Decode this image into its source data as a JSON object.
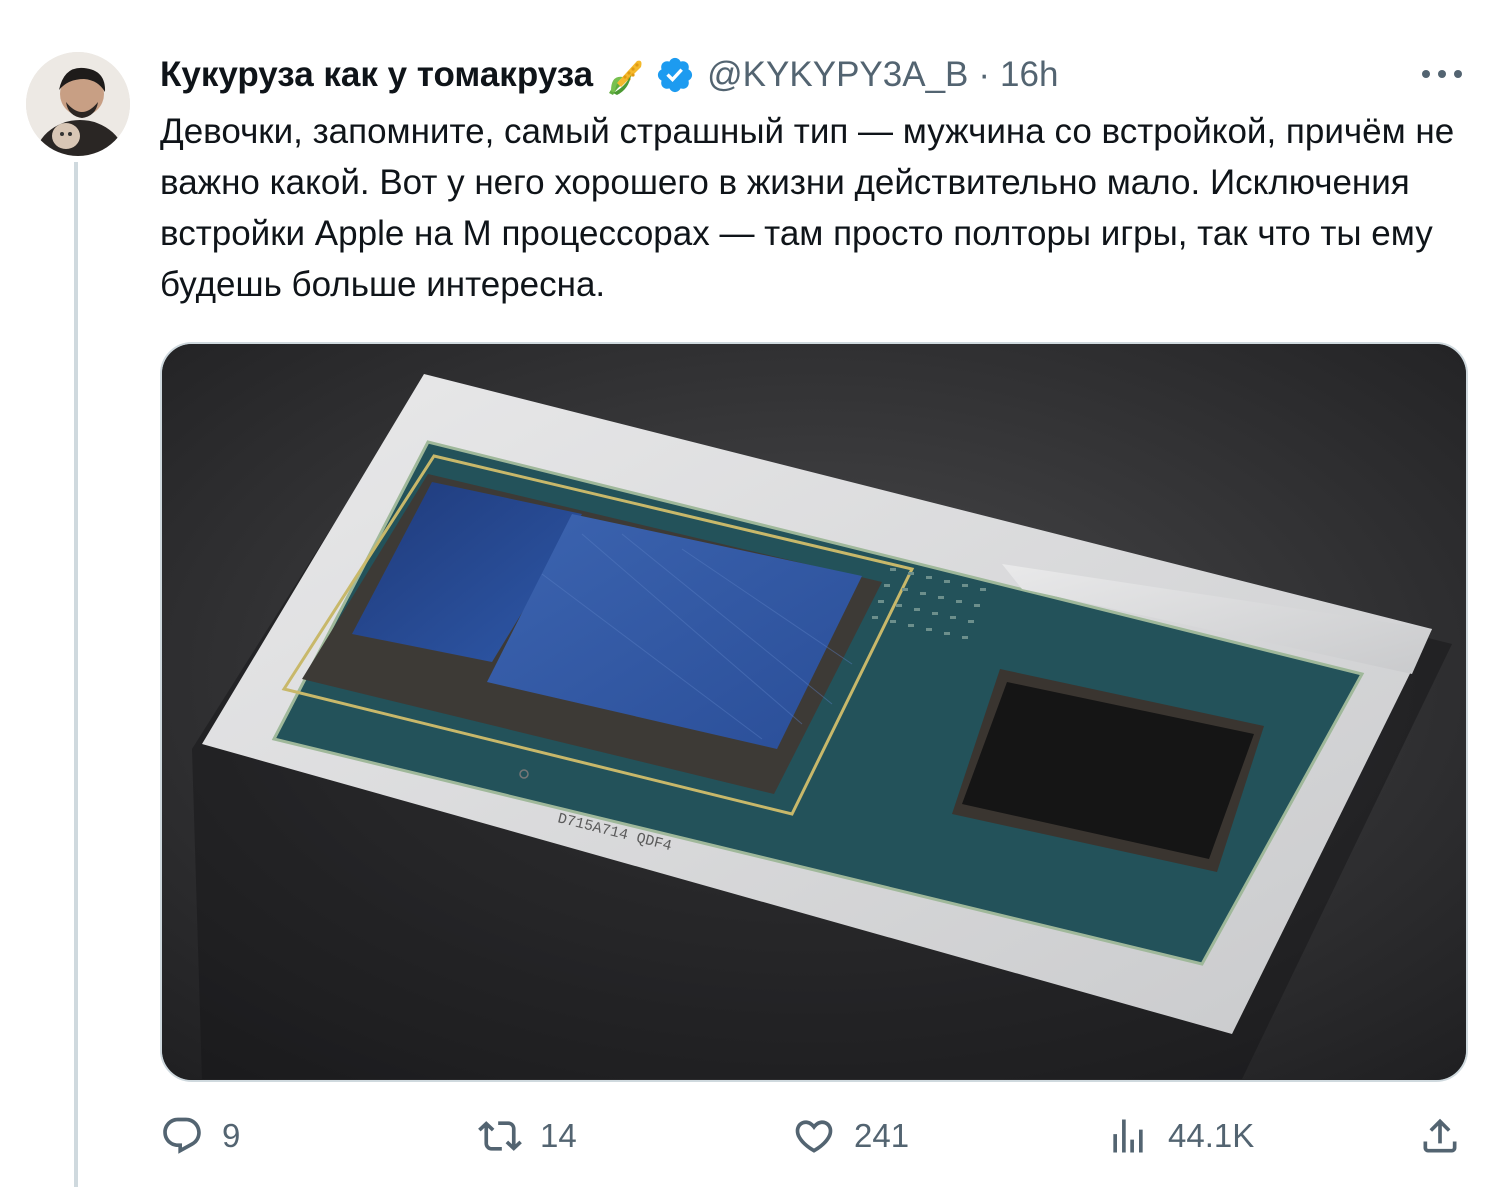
{
  "tweet": {
    "display_name": "Кукуруза как у томакруза",
    "handle": "@KYKYPY3A_B",
    "separator": "·",
    "time": "16h",
    "text": "Девочки, запомните, самый страшный тип — мужчина со встройкой, причём не важно какой. Вот у него хорошего в жизни действительно мало. Исключения встройки Apple на M процессорах — там просто полторы игры, так что ты ему будешь больше интересна.",
    "media_chip_marking": "D715A714 QDF4"
  },
  "actions": {
    "replies": "9",
    "retweets": "14",
    "likes": "241",
    "views": "44.1K"
  },
  "colors": {
    "verified": "#1d9bf0",
    "muted_text": "#536471",
    "primary_text": "#0f1419"
  },
  "icons": [
    "corn-icon",
    "verified-icon",
    "more-icon",
    "reply-icon",
    "retweet-icon",
    "like-icon",
    "views-icon",
    "share-icon"
  ]
}
